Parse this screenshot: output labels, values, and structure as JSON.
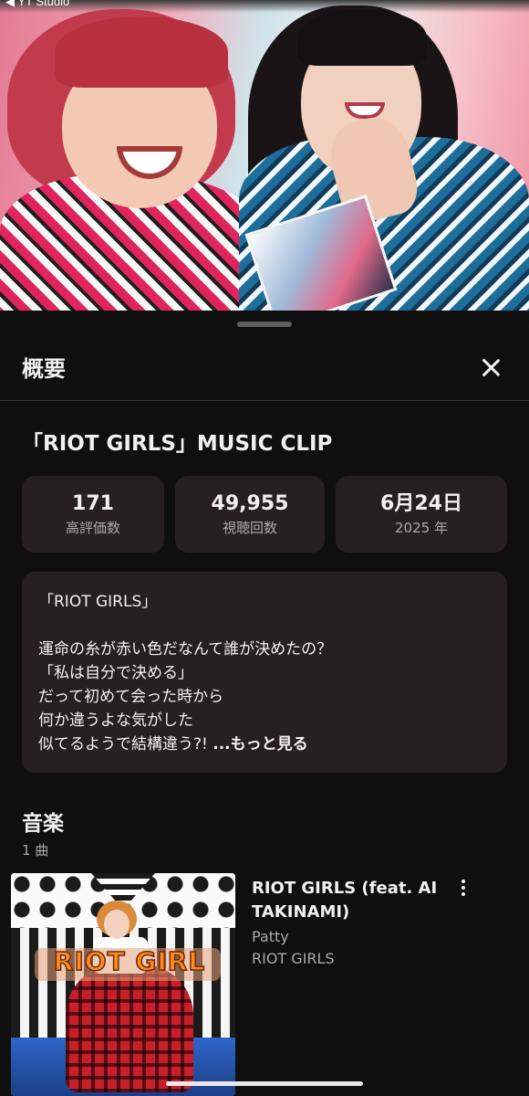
{
  "video": {
    "studio_label": "◀ YT Studio"
  },
  "panel": {
    "header": "概要",
    "close_icon": "close-icon",
    "video_title": "「RIOT GIRLS」MUSIC CLIP"
  },
  "stats": [
    {
      "value": "171",
      "label": "高評価数"
    },
    {
      "value": "49,955",
      "label": "視聴回数"
    },
    {
      "value": "6月24日",
      "label": "2025 年"
    }
  ],
  "description": {
    "text": "「RIOT GIRLS」\n\n運命の糸が赤い色だなんて誰が決めたの？\n「私は自分で決める」\nだって初めて会った時から\n何か違うよな気がした\n似てるようで結構違う?! ",
    "more_label": "...もっと見る"
  },
  "music": {
    "section_title": "音楽",
    "count": "1 曲",
    "track": {
      "title": "RIOT GIRLS (feat. AI TAKINAMI)",
      "artist": "Patty",
      "album": "RIOT GIRLS",
      "art_logo": "RIOT GIRL",
      "menu_icon": "more-vert-icon"
    }
  },
  "colors": {
    "background": "#0f0f0f",
    "card": "#272021",
    "text_primary": "#f1f1f1",
    "text_secondary": "#aaaaaa"
  }
}
